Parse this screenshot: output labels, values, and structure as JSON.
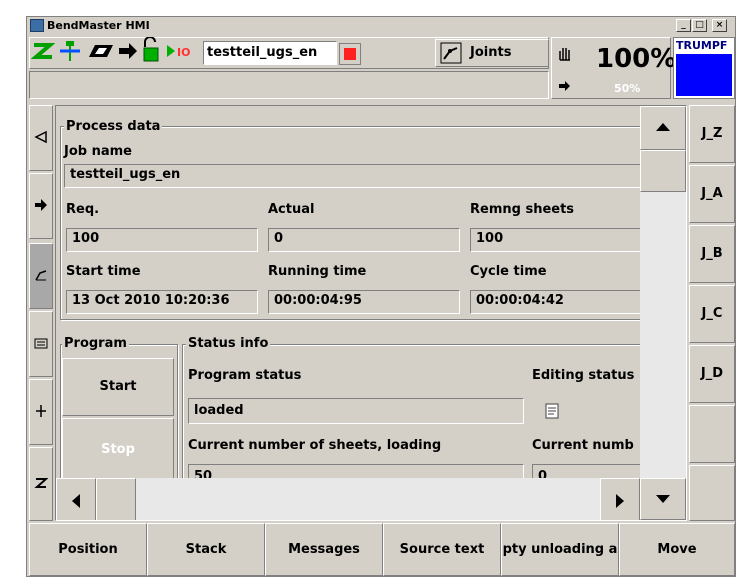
{
  "window": {
    "title": "BendMaster HMI",
    "min_label": "_",
    "max_label": "□",
    "close_label": "×"
  },
  "toolbar": {
    "job_field": "testteil_ugs_en",
    "mode_label": "Joints",
    "override_percent": "100%",
    "speed_percent": "50%",
    "brand": "TRUMPF",
    "brand_color": "#0000ff",
    "stop_color": "#ff2020",
    "icons": [
      "z-axis-icon",
      "tool-icon",
      "run-icon",
      "next-icon",
      "unlock-icon",
      "io-icon"
    ]
  },
  "process": {
    "title": "Process data",
    "job_name_label": "Job name",
    "job_name_value": "testteil_ugs_en",
    "req_label": "Req.",
    "req_value": "100",
    "actual_label": "Actual",
    "actual_value": "0",
    "remng_label": "Remng sheets",
    "remng_value": "100",
    "start_time_label": "Start time",
    "start_time_value": "13 Oct 2010 10:20:36",
    "running_time_label": "Running time",
    "running_time_value": "00:00:04:95",
    "cycle_time_label": "Cycle time",
    "cycle_time_value": "00:00:04:42"
  },
  "program": {
    "title": "Program",
    "start_label": "Start",
    "stop_label": "Stop"
  },
  "status": {
    "title": "Status info",
    "program_status_label": "Program status",
    "program_status_value": "loaded",
    "editing_status_label": "Editing status",
    "current_sheets_label": "Current number of sheets, loading",
    "current_sheets_value": "50",
    "current_numb_label": "Current numb",
    "current_numb_value": "0"
  },
  "right_buttons": [
    "J_Z",
    "J_A",
    "J_B",
    "J_C",
    "J_D"
  ],
  "bottom_buttons": [
    "Position",
    "Stack",
    "Messages",
    "Source text",
    "pty unloading a",
    "Move"
  ]
}
